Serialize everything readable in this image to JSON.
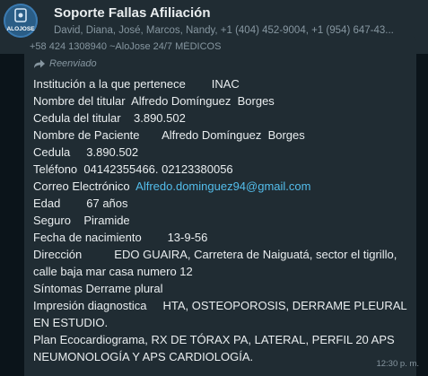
{
  "header": {
    "title": "Soporte Fallas Afiliación",
    "participants": "David, Diana, José, Marcos, Nandy, +1 (404) 452-9004, +1 (954) 647-43..."
  },
  "avatar_text": "ALOJOSE",
  "message": {
    "cut_top_line": "+58 424 1308940 ~AloJose 24/7 MÉDICOS",
    "forwarded_label": "Reenviado",
    "lines": {
      "institucion": "Institución a la que pertenece        INAC",
      "nombre_titular": "Nombre del titular  Alfredo Domínguez  Borges",
      "cedula_titular": "Cedula del titular    3.890.502",
      "nombre_paciente": "Nombre de Paciente       Alfredo Domínguez  Borges",
      "cedula": "Cedula     3.890.502",
      "telefono": "Teléfono  04142355466. 02123380056",
      "correo_label": "Correo Electrónico  ",
      "correo_value": "Alfredo.dominguez94@gmail.com",
      "edad": "Edad        67 años",
      "seguro": "Seguro    Piramide",
      "fecha": "Fecha de nacimiento        13-9-56",
      "direccion": "Dirección          EDO GUAIRA, Carretera de Naiguatá, sector el tigrillo, calle baja mar casa numero 12",
      "sintomas": "Síntomas Derrame plural",
      "impresion": "Impresión diagnostica     HTA, OSTEOPOROSIS, DERRAME PLEURAL EN ESTUDIO.",
      "plan": "Plan Ecocardiograma, RX DE TÓRAX PA, LATERAL, PERFIL 20 APS NEUMONOLOGÍA Y APS CARDIOLOGÍA."
    },
    "time": "12:30 p. m."
  },
  "colors": {
    "header_bg": "#202c33",
    "chat_bg": "#0b141a",
    "bubble_bg": "#202c33",
    "link": "#53bdeb",
    "muted_text": "#8696a0"
  }
}
